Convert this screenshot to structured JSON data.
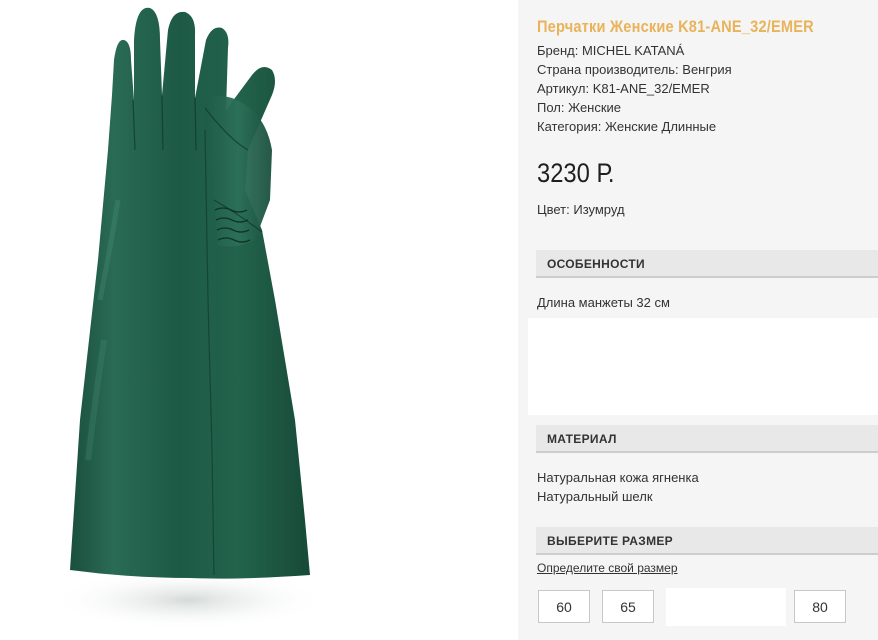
{
  "product": {
    "title": "Перчатки Женские K81-ANE_32/EMER",
    "attributes": [
      "Бренд: MICHEL KATANÁ",
      "Страна производитель: Венгрия",
      "Артикул: K81-ANE_32/EMER",
      "Пол: Женские",
      "Категория: Женские Длинные"
    ],
    "price": "3230 Р.",
    "color_label": "Цвет: Изумруд",
    "image_icon": "emerald-long-glove"
  },
  "sections": {
    "features": {
      "heading": "ОСОБЕННОСТИ",
      "lines": [
        "Длина манжеты 32 см"
      ]
    },
    "material": {
      "heading": "МАТЕРИАЛ",
      "lines": [
        "Натуральная кожа ягненка",
        "Натуральный шелк"
      ]
    },
    "size": {
      "heading": "ВЫБЕРИТЕ РАЗМЕР",
      "link": "Определите свой размер",
      "options": [
        "60",
        "65",
        "80"
      ]
    }
  },
  "colors": {
    "title_accent": "#e9b35a",
    "glove_green": "#1d5a45",
    "section_bg": "#e8e8e8",
    "panel_bg": "#f5f5f5"
  }
}
